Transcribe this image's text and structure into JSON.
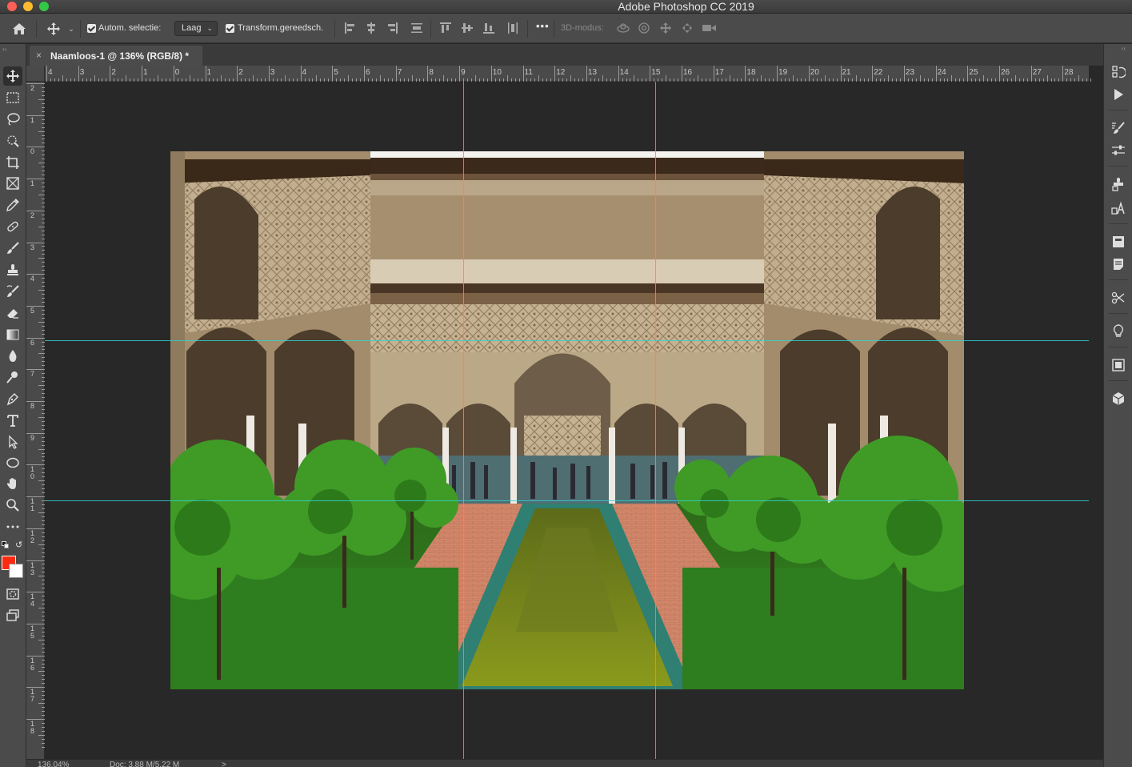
{
  "window": {
    "title": "Adobe Photoshop CC 2019"
  },
  "options_bar": {
    "auto_select_label": "Autom. selectie:",
    "auto_select_value": "Laag",
    "transform_label": "Transform.gereedsch.",
    "more_label": "•••",
    "mode3d_label": "3D-modus:"
  },
  "document": {
    "tab_close": "×",
    "tab_title": "Naamloos-1 @ 136% (RGB/8) *"
  },
  "ruler": {
    "horizontal_labels": [
      "4",
      "3",
      "2",
      "1",
      "0",
      "1",
      "2",
      "3",
      "4",
      "5",
      "6",
      "7",
      "8",
      "9",
      "10",
      "11",
      "12",
      "13",
      "14",
      "15",
      "16",
      "17",
      "18",
      "19",
      "20",
      "21",
      "22",
      "23",
      "24",
      "25",
      "26",
      "27",
      "28"
    ],
    "vertical_labels": [
      "2",
      "1",
      "0",
      "1",
      "2",
      "3",
      "4",
      "5",
      "6",
      "7",
      "8",
      "9",
      "1\n0",
      "1\n1",
      "1\n2",
      "1\n3",
      "1\n4",
      "1\n5",
      "1\n6",
      "1\n7",
      "1\n8"
    ]
  },
  "status_bar": {
    "zoom": "136,04%",
    "doc_size": "Doc: 3,88 M/5,22 M",
    "arrow": ">"
  },
  "colors": {
    "foreground": "#ff2a0f",
    "background": "#ffffff",
    "guide": "#2fd1d1"
  },
  "tools": [
    "move-tool",
    "marquee-tool",
    "lasso-tool",
    "quick-select-tool",
    "crop-tool",
    "frame-tool",
    "eyedropper-tool",
    "healing-brush-tool",
    "brush-tool",
    "clone-stamp-tool",
    "history-brush-tool",
    "eraser-tool",
    "gradient-tool",
    "blur-tool",
    "dodge-tool",
    "pen-tool",
    "type-tool",
    "path-select-tool",
    "ellipse-tool",
    "hand-tool",
    "zoom-tool",
    "more-tools"
  ]
}
